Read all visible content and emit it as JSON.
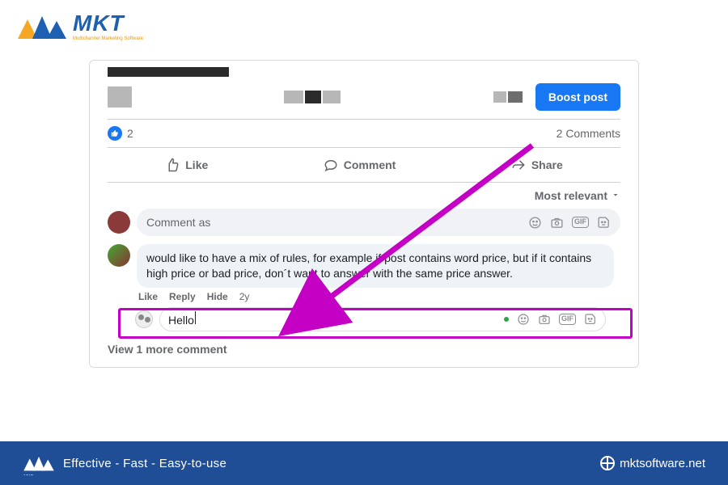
{
  "branding": {
    "name": "MKT",
    "tagline": "Multichannel Marketing Software"
  },
  "post": {
    "boost_label": "Boost post",
    "like_count": "2",
    "comments_count_label": "2 Comments",
    "actions": {
      "like": "Like",
      "comment": "Comment",
      "share": "Share"
    },
    "sort_label": "Most relevant",
    "comment_input_placeholder": "Comment as",
    "existing_comment": {
      "text": "would like to have a mix of rules, for example if post contains word price, but if it contains high price or bad price, don´t want to answer with the same price answer.",
      "sub": {
        "like": "Like",
        "reply": "Reply",
        "hide": "Hide",
        "time": "2y"
      }
    },
    "reply_value": "Hello",
    "view_more_label": "View 1 more comment"
  },
  "footer": {
    "slogan": "Effective - Fast - Easy-to-use",
    "site": "mktsoftware.net"
  }
}
